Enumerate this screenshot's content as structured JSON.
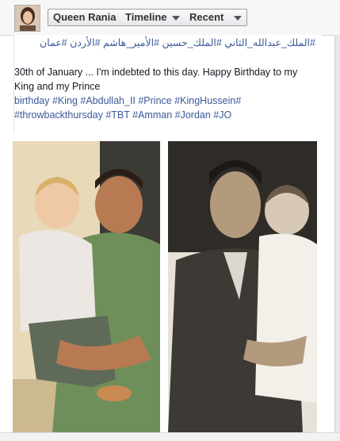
{
  "header": {
    "profile_name": "Queen Rania",
    "timeline_label": "Timeline",
    "recent_label": "Recent"
  },
  "post": {
    "arabic_hashtags": "#الملك_عبدالله_الثاني #الملك_حسين #الأمير_هاشم #الأردن #عمان",
    "caption_line1": "30th of January ... I'm indebted to this day. Happy Birthday to my",
    "caption_line2": "King and my Prince",
    "hashtags_line1": "birthday #King #Abdullah_II #Prince #KingHussein#",
    "hashtags_line2": "#throwbackthursday #TBT #Amman #Jordan #JO"
  },
  "colors": {
    "link": "#3b5998",
    "text": "#141823"
  },
  "icons": [
    "chevron-down-icon"
  ]
}
